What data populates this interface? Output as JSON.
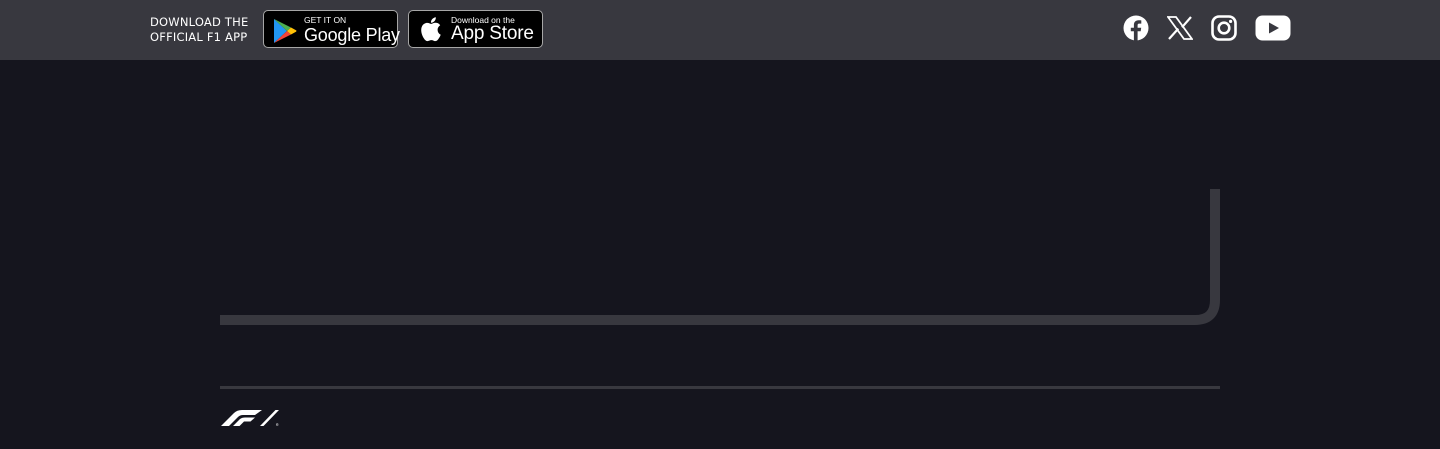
{
  "app_promo": {
    "line1": "DOWNLOAD THE",
    "line2": "OFFICIAL F1 APP"
  },
  "google_play": {
    "small_text": "GET IT ON",
    "big_text": "Google Play",
    "icon": "google-play-icon"
  },
  "app_store": {
    "small_text": "Download on the",
    "big_text": "App Store",
    "icon": "apple-icon"
  },
  "social_links": [
    {
      "name": "Facebook",
      "icon": "facebook-icon"
    },
    {
      "name": "X",
      "icon": "x-icon"
    },
    {
      "name": "Instagram",
      "icon": "instagram-icon"
    },
    {
      "name": "YouTube",
      "icon": "youtube-icon"
    }
  ],
  "footer": {
    "logo": "f1-logo"
  },
  "colors": {
    "topbar": "#38383f",
    "background": "#15151e",
    "frame_stroke": "#38383f",
    "text": "#ffffff"
  }
}
